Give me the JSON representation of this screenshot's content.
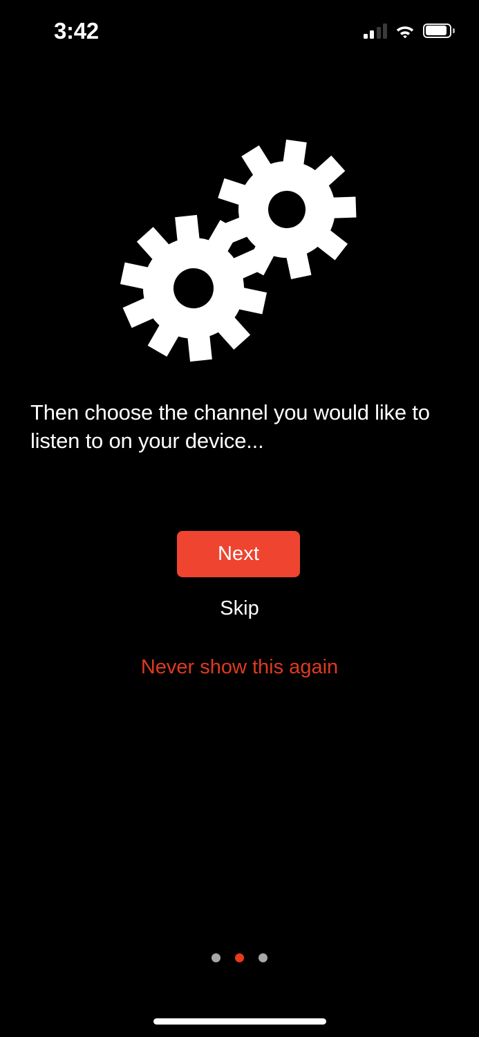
{
  "status_bar": {
    "time": "3:42",
    "signal_icon": "cellular-signal-icon",
    "signal_bars_total": 4,
    "signal_bars_filled": 2,
    "wifi_icon": "wifi-icon",
    "battery_icon": "battery-icon",
    "battery_level_pct": 85
  },
  "hero": {
    "illustration": "two-gears-icon",
    "gear_color": "#ffffff"
  },
  "content": {
    "headline": "Then choose the channel you would like to listen to on your device..."
  },
  "actions": {
    "next_label": "Next",
    "next_color": "#ee4430",
    "skip_label": "Skip",
    "skip_color": "#ffffff",
    "never_label": "Never show this again",
    "never_color": "#e03a20"
  },
  "pagination": {
    "total": 3,
    "active_index": 1,
    "inactive_color": "#a8a8a8",
    "active_color": "#e8391a"
  },
  "system": {
    "home_indicator": "home-indicator-bar",
    "background_color": "#000000"
  }
}
